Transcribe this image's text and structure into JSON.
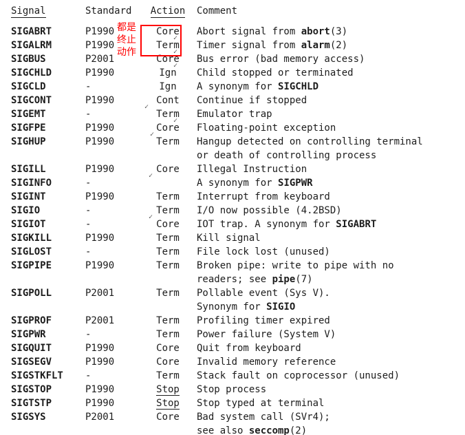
{
  "header": {
    "signal": "Signal",
    "standard": "Standard",
    "action": "Action",
    "comment": "Comment"
  },
  "annotations": {
    "line1": "都是",
    "line2": "终止",
    "line3": "动作"
  },
  "rows": [
    {
      "signal": "SIGABRT",
      "standard": "P1990",
      "action": "Core",
      "comment": "Abort signal from ",
      "bold": "abort",
      "suffix": "(3)"
    },
    {
      "signal": "SIGALRM",
      "standard": "P1990",
      "action": "Term",
      "comment": "Timer signal from ",
      "bold": "alarm",
      "suffix": "(2)"
    },
    {
      "signal": "SIGBUS",
      "standard": "P2001",
      "action": "Core",
      "comment": "Bus error (bad memory access)"
    },
    {
      "signal": "SIGCHLD",
      "standard": "P1990",
      "action": "Ign",
      "comment": "Child stopped or terminated"
    },
    {
      "signal": "SIGCLD",
      "standard": "-",
      "action": "Ign",
      "comment": "A synonym for ",
      "bold": "SIGCHLD"
    },
    {
      "signal": "SIGCONT",
      "standard": "P1990",
      "action": "Cont",
      "comment": "Continue if stopped"
    },
    {
      "signal": "SIGEMT",
      "standard": "-",
      "action": "Term",
      "comment": "Emulator trap"
    },
    {
      "signal": "SIGFPE",
      "standard": "P1990",
      "action": "Core",
      "comment": "Floating-point exception"
    },
    {
      "signal": "SIGHUP",
      "standard": "P1990",
      "action": "Term",
      "comment": "Hangup detected on controlling terminal",
      "cont": "or death of controlling process"
    },
    {
      "signal": "SIGILL",
      "standard": "P1990",
      "action": "Core",
      "comment": "Illegal Instruction"
    },
    {
      "signal": "SIGINFO",
      "standard": "-",
      "action": "",
      "comment": "A synonym for ",
      "bold": "SIGPWR"
    },
    {
      "signal": "SIGINT",
      "standard": "P1990",
      "action": "Term",
      "comment": "Interrupt from keyboard"
    },
    {
      "signal": "SIGIO",
      "standard": "-",
      "action": "Term",
      "comment": "I/O now possible (4.2BSD)"
    },
    {
      "signal": "SIGIOT",
      "standard": "-",
      "action": "Core",
      "comment": "IOT trap. A synonym for ",
      "bold": "SIGABRT"
    },
    {
      "signal": "SIGKILL",
      "standard": "P1990",
      "action": "Term",
      "comment": "Kill signal"
    },
    {
      "signal": "SIGLOST",
      "standard": "-",
      "action": "Term",
      "comment": "File lock lost (unused)"
    },
    {
      "signal": "SIGPIPE",
      "standard": "P1990",
      "action": "Term",
      "comment": "Broken pipe: write to pipe with no",
      "cont": "readers; see ",
      "cont_bold": "pipe",
      "cont_suffix": "(7)"
    },
    {
      "signal": "SIGPOLL",
      "standard": "P2001",
      "action": "Term",
      "comment": "Pollable event (Sys V).",
      "cont": "Synonym for ",
      "cont_bold": "SIGIO"
    },
    {
      "signal": "SIGPROF",
      "standard": "P2001",
      "action": "Term",
      "comment": "Profiling timer expired"
    },
    {
      "signal": "SIGPWR",
      "standard": "-",
      "action": "Term",
      "comment": "Power failure (System V)"
    },
    {
      "signal": "SIGQUIT",
      "standard": "P1990",
      "action": "Core",
      "comment": "Quit from keyboard"
    },
    {
      "signal": "SIGSEGV",
      "standard": "P1990",
      "action": "Core",
      "comment": "Invalid memory reference"
    },
    {
      "signal": "SIGSTKFLT",
      "standard": "-",
      "action": "Term",
      "comment": "Stack fault on coprocessor (unused)"
    },
    {
      "signal": "SIGSTOP",
      "standard": "P1990",
      "action": "Stop",
      "action_underline": true,
      "comment": "Stop process"
    },
    {
      "signal": "SIGTSTP",
      "standard": "P1990",
      "action": "Stop",
      "action_underline": true,
      "comment": "Stop typed at terminal"
    },
    {
      "signal": "SIGSYS",
      "standard": "P2001",
      "action": "Core",
      "comment": "Bad system call (SVr4);",
      "cont": "see also ",
      "cont_bold": "seccomp",
      "cont_suffix": "(2)"
    }
  ]
}
